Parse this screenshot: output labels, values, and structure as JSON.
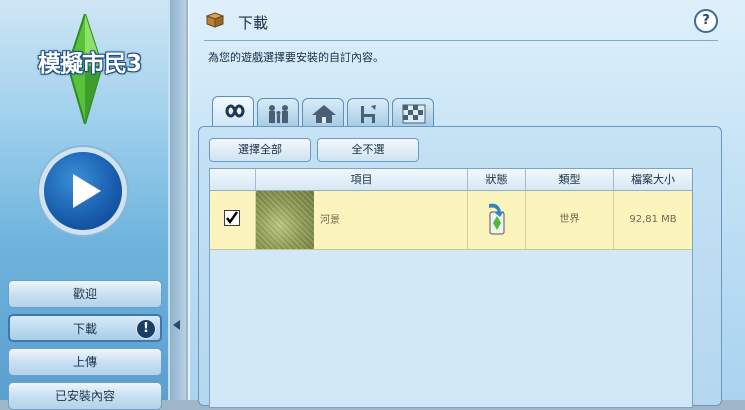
{
  "sidebar": {
    "logo_text": "模擬市民3",
    "nav": [
      {
        "label": "歡迎"
      },
      {
        "label": "下載"
      },
      {
        "label": "上傳"
      },
      {
        "label": "已安裝內容"
      }
    ]
  },
  "header": {
    "title": "下載",
    "subtitle": "為您的遊戲選擇要安裝的自訂內容。",
    "help": "?"
  },
  "tabs": [
    {
      "icon": "infinity-icon"
    },
    {
      "icon": "family-icon"
    },
    {
      "icon": "house-icon"
    },
    {
      "icon": "chair-icon"
    },
    {
      "icon": "pattern-icon"
    }
  ],
  "buttons": {
    "select_all": "選擇全部",
    "select_none": "全不選"
  },
  "table": {
    "columns": [
      "項目",
      "狀態",
      "類型",
      "檔案大小"
    ],
    "rows": [
      {
        "checked": true,
        "name": "河景",
        "status_icon": "installer-icon",
        "type": "世界",
        "size": "92,81 MB"
      }
    ]
  },
  "colors": {
    "row_highlight": "#fbf5bd",
    "accent": "#1a5fb0"
  }
}
